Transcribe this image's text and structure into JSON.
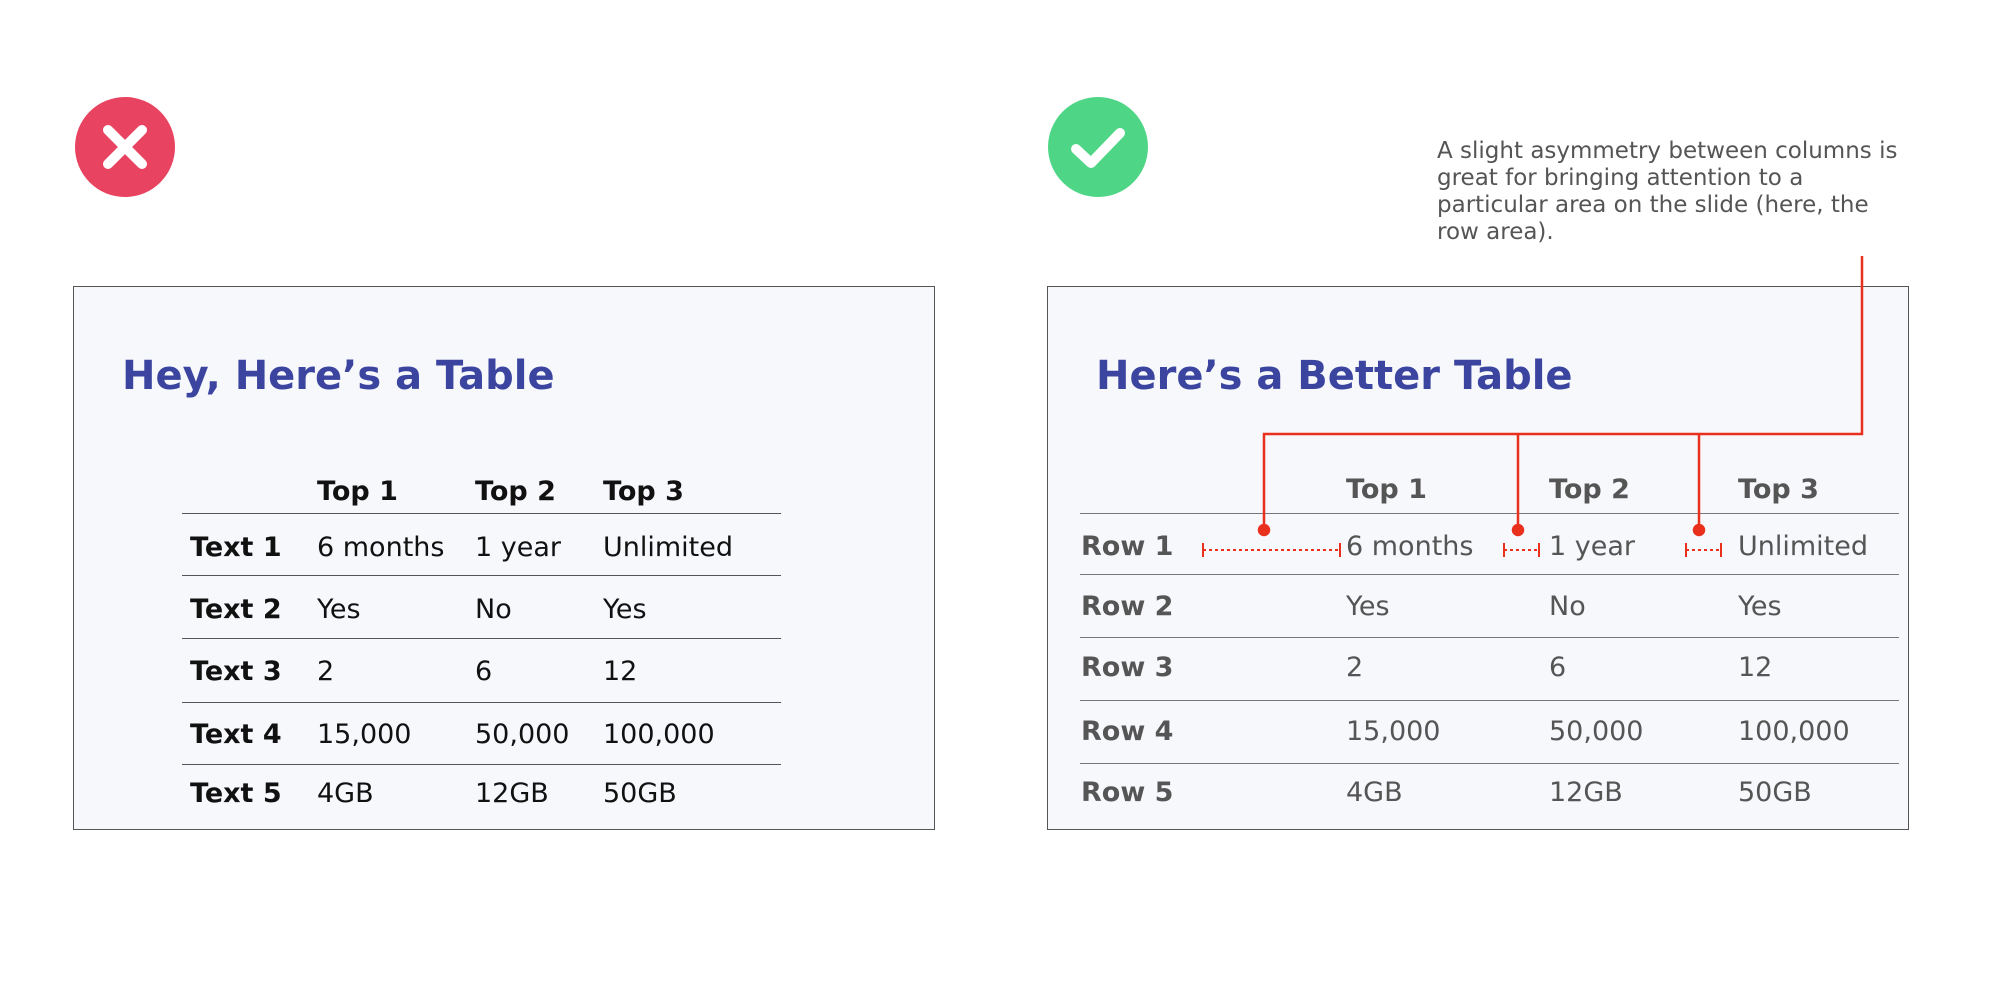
{
  "colors": {
    "bad_badge": "#e84361",
    "good_badge": "#4ed686",
    "title_blue": "#3b45a0",
    "slide_background": "#f7f8fc",
    "annotation_red": "#e8301c"
  },
  "icons": {
    "bad_badge": "close-icon",
    "good_badge": "checkmark-icon"
  },
  "annotation": {
    "text": "A slight asymmetry between columns is great for bringing attention to a particular area on the slide (here, the row area)."
  },
  "bad_slide": {
    "title": "Hey, Here’s a Table",
    "table": {
      "columns": [
        "Top 1",
        "Top 2",
        "Top 3"
      ],
      "rows": [
        {
          "label": "Text 1",
          "cells": [
            "6 months",
            "1 year",
            "Unlimited"
          ]
        },
        {
          "label": "Text 2",
          "cells": [
            "Yes",
            "No",
            "Yes"
          ]
        },
        {
          "label": "Text 3",
          "cells": [
            "2",
            "6",
            "12"
          ]
        },
        {
          "label": "Text 4",
          "cells": [
            "15,000",
            "50,000",
            "100,000"
          ]
        },
        {
          "label": "Text 5",
          "cells": [
            "4GB",
            "12GB",
            "50GB"
          ]
        }
      ]
    }
  },
  "good_slide": {
    "title": "Here’s a Better Table",
    "table": {
      "columns": [
        "Top 1",
        "Top 2",
        "Top 3"
      ],
      "rows": [
        {
          "label": "Row 1",
          "cells": [
            "6 months",
            "1 year",
            "Unlimited"
          ]
        },
        {
          "label": "Row 2",
          "cells": [
            "Yes",
            "No",
            "Yes"
          ]
        },
        {
          "label": "Row 3",
          "cells": [
            "2",
            "6",
            "12"
          ]
        },
        {
          "label": "Row 4",
          "cells": [
            "15,000",
            "50,000",
            "100,000"
          ]
        },
        {
          "label": "Row 5",
          "cells": [
            "4GB",
            "12GB",
            "50GB"
          ]
        }
      ]
    }
  }
}
